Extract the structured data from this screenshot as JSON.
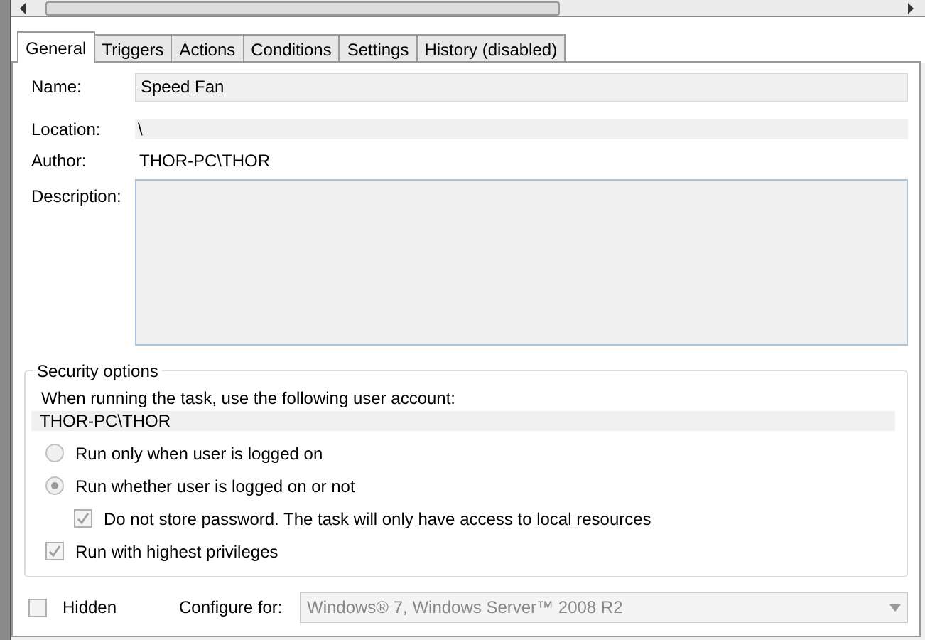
{
  "tabs": [
    {
      "label": "General",
      "selected": true
    },
    {
      "label": "Triggers",
      "selected": false
    },
    {
      "label": "Actions",
      "selected": false
    },
    {
      "label": "Conditions",
      "selected": false
    },
    {
      "label": "Settings",
      "selected": false
    },
    {
      "label": "History (disabled)",
      "selected": false
    }
  ],
  "general": {
    "name": {
      "label": "Name:",
      "value": "Speed Fan"
    },
    "location": {
      "label": "Location:",
      "value": "\\"
    },
    "author": {
      "label": "Author:",
      "value": "THOR-PC\\THOR"
    },
    "description": {
      "label": "Description:"
    }
  },
  "security": {
    "title": "Security options",
    "prompt": "When running the task, use the following user account:",
    "account": "THOR-PC\\THOR",
    "options": [
      {
        "kind": "radio",
        "label": "Run only when user is logged on",
        "selected": false
      },
      {
        "kind": "radio",
        "label": "Run whether user is logged on or not",
        "selected": true,
        "children": [
          {
            "kind": "checkbox",
            "label": "Do not store password.  The task will only have access to local resources",
            "checked": true
          }
        ]
      },
      {
        "kind": "checkbox",
        "label": "Run with highest privileges",
        "checked": true
      }
    ]
  },
  "hidden": {
    "label": "Hidden",
    "checked": false
  },
  "configure": {
    "label": "Configure for:",
    "value": "Windows® 7, Windows Server™ 2008 R2"
  }
}
